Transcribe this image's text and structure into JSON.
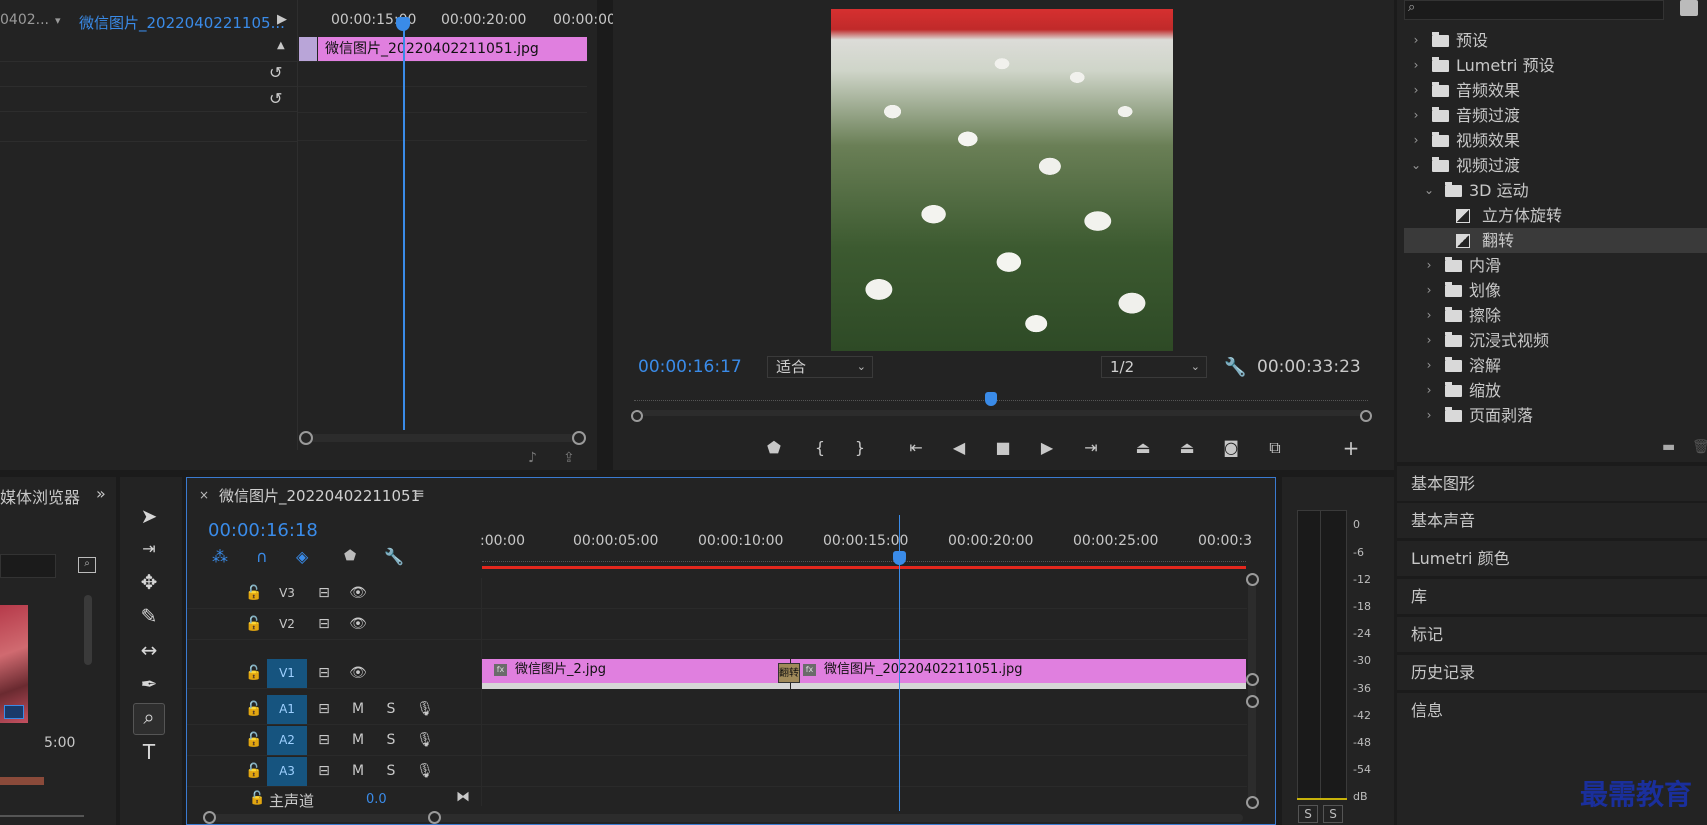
{
  "effect_controls": {
    "source_label": "0402...",
    "clip_selector": "微信图片_2022040221105...",
    "timecodes": [
      "00:00:15:00",
      "00:00:20:00",
      "00:00:00"
    ],
    "clip_name": "微信图片_20220402211051.jpg"
  },
  "program_monitor": {
    "current_time": "00:00:16:17",
    "fit": "适合",
    "resolution": "1/2",
    "duration": "00:00:33:23",
    "buttons": [
      "marker-icon",
      "mark-in-icon",
      "mark-out-icon",
      "go-to-in-icon",
      "step-back-icon",
      "stop-icon",
      "step-forward-icon",
      "go-to-out-icon",
      "lift-icon",
      "extract-icon",
      "camera-icon",
      "compare-icon",
      "add-icon"
    ]
  },
  "effects": {
    "items": [
      {
        "label": "预设",
        "type": "folder-special",
        "level": 0,
        "expanded": false
      },
      {
        "label": "Lumetri 预设",
        "type": "folder-special",
        "level": 0,
        "expanded": false
      },
      {
        "label": "音频效果",
        "type": "folder",
        "level": 0,
        "expanded": false
      },
      {
        "label": "音频过渡",
        "type": "folder",
        "level": 0,
        "expanded": false
      },
      {
        "label": "视频效果",
        "type": "folder",
        "level": 0,
        "expanded": false
      },
      {
        "label": "视频过渡",
        "type": "folder",
        "level": 0,
        "expanded": true
      },
      {
        "label": "3D 运动",
        "type": "folder",
        "level": 1,
        "expanded": true
      },
      {
        "label": "立方体旋转",
        "type": "transition",
        "level": 2
      },
      {
        "label": "翻转",
        "type": "transition",
        "level": 2,
        "selected": true
      },
      {
        "label": "内滑",
        "type": "folder",
        "level": 1,
        "expanded": false
      },
      {
        "label": "划像",
        "type": "folder",
        "level": 1,
        "expanded": false
      },
      {
        "label": "擦除",
        "type": "folder",
        "level": 1,
        "expanded": false
      },
      {
        "label": "沉浸式视频",
        "type": "folder",
        "level": 1,
        "expanded": false
      },
      {
        "label": "溶解",
        "type": "folder",
        "level": 1,
        "expanded": false
      },
      {
        "label": "缩放",
        "type": "folder",
        "level": 1,
        "expanded": false
      },
      {
        "label": "页面剥落",
        "type": "folder",
        "level": 1,
        "expanded": false
      }
    ]
  },
  "side_panels": [
    "基本图形",
    "基本声音",
    "Lumetri 颜色",
    "库",
    "标记",
    "历史记录",
    "信息"
  ],
  "project": {
    "tab_label": "媒体浏览器",
    "thumb_duration": "5:00"
  },
  "timeline": {
    "tab_title": "微信图片_20220402211051",
    "current_time": "00:00:16:18",
    "ruler": [
      ":00:00",
      "00:00:05:00",
      "00:00:10:00",
      "00:00:15:00",
      "00:00:20:00",
      "00:00:25:00",
      "00:00:3"
    ],
    "tracks": [
      {
        "id": "V3",
        "kind": "video",
        "target": false
      },
      {
        "id": "V2",
        "kind": "video",
        "target": false
      },
      {
        "id": "V1",
        "kind": "video",
        "target": true
      },
      {
        "id": "A1",
        "kind": "audio",
        "target": true
      },
      {
        "id": "A2",
        "kind": "audio",
        "target": true
      },
      {
        "id": "A3",
        "kind": "audio",
        "target": true
      }
    ],
    "audio_mute": "M",
    "audio_solo": "S",
    "master_label": "主声道",
    "master_value": "0.0",
    "clips": [
      {
        "name": "微信图片_2.jpg"
      },
      {
        "name": "微信图片_20220402211051.jpg"
      }
    ],
    "transition_label": "翻转"
  },
  "audio_meter": {
    "db_ticks": [
      "0",
      "-6",
      "-12",
      "-18",
      "-24",
      "-30",
      "-36",
      "-42",
      "-48",
      "-54",
      "dB"
    ],
    "solo_buttons": [
      "S",
      "S"
    ]
  },
  "watermark": "最需教育"
}
